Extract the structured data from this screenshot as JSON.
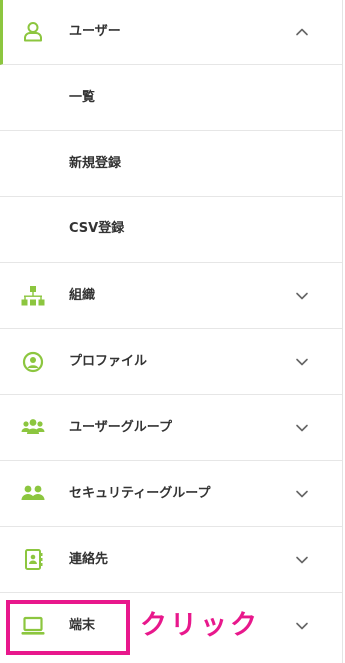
{
  "colors": {
    "accent": "#8cc63f",
    "highlight": "#e8188c",
    "text": "#333333",
    "divider": "#e6e6e6"
  },
  "menu": {
    "users": {
      "label": "ユーザー",
      "icon": "user-icon",
      "expanded": true,
      "children": [
        {
          "label": "一覧"
        },
        {
          "label": "新規登録"
        },
        {
          "label": "CSV登録"
        }
      ]
    },
    "items": [
      {
        "label": "組織",
        "icon": "org-chart-icon"
      },
      {
        "label": "プロファイル",
        "icon": "profile-icon"
      },
      {
        "label": "ユーザーグループ",
        "icon": "user-group-icon"
      },
      {
        "label": "セキュリティーグループ",
        "icon": "security-group-icon"
      },
      {
        "label": "連絡先",
        "icon": "contacts-icon"
      },
      {
        "label": "端末",
        "icon": "laptop-icon"
      }
    ]
  },
  "annotation": {
    "label": "クリック"
  }
}
